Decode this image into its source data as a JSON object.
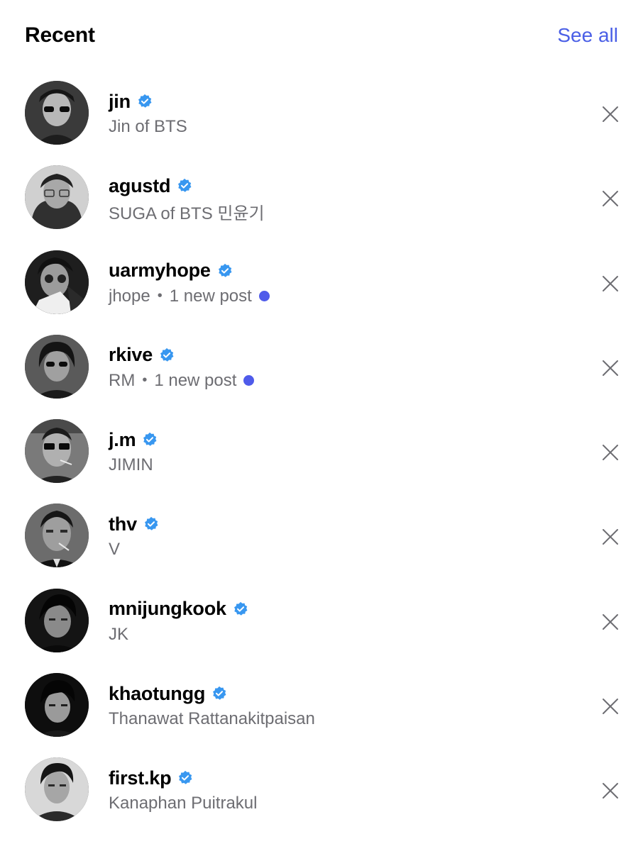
{
  "header": {
    "title": "Recent",
    "see_all": "See all"
  },
  "accent_color": "#4a5fe6",
  "verified_color": "#3897f0",
  "new_post_dot_color": "#4f5bea",
  "icons": {
    "verified": "verified-badge-icon",
    "remove": "close-icon"
  },
  "rows": [
    {
      "username": "jin",
      "subtitle": "Jin of BTS",
      "separator": "",
      "new_post": ""
    },
    {
      "username": "agustd",
      "subtitle": "SUGA of BTS 민윤기",
      "separator": "",
      "new_post": ""
    },
    {
      "username": "uarmyhope",
      "subtitle": "jhope",
      "separator": "•",
      "new_post": "1 new post"
    },
    {
      "username": "rkive",
      "subtitle": "RM",
      "separator": "•",
      "new_post": "1 new post"
    },
    {
      "username": "j.m",
      "subtitle": "JIMIN",
      "separator": "",
      "new_post": ""
    },
    {
      "username": "thv",
      "subtitle": "V",
      "separator": "",
      "new_post": ""
    },
    {
      "username": "mnijungkook",
      "subtitle": "JK",
      "separator": "",
      "new_post": ""
    },
    {
      "username": "khaotungg",
      "subtitle": "Thanawat Rattanakitpaisan",
      "separator": "",
      "new_post": ""
    },
    {
      "username": "first.kp",
      "subtitle": "Kanaphan Puitrakul",
      "separator": "",
      "new_post": ""
    }
  ]
}
